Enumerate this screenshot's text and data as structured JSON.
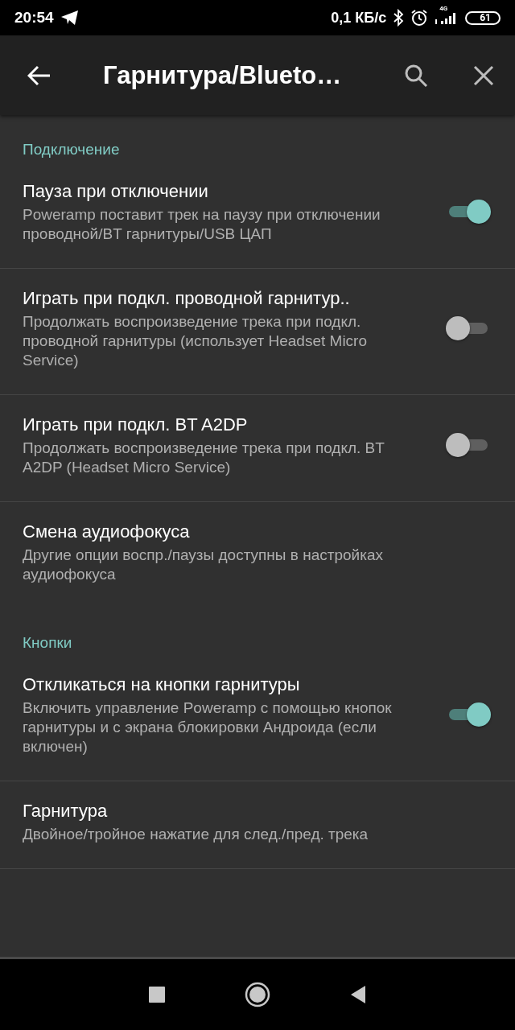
{
  "status_bar": {
    "time": "20:54",
    "speed": "0,1 КБ/с",
    "network": "4G",
    "battery": "61"
  },
  "toolbar": {
    "title": "Гарнитура/Blueto…"
  },
  "sections": [
    {
      "header": "Подключение",
      "items": [
        {
          "kind": "switch",
          "title": "Пауза при отключении",
          "subtitle": "Poweramp поставит трек на паузу при отключении проводной/BT гарнитуры/USB ЦАП",
          "on": true,
          "divider": true
        },
        {
          "kind": "switch",
          "title": "Играть при подкл. проводной гарнитур..",
          "subtitle": "Продолжать воспроизведение трека при подкл. проводной гарнитуры (использует Headset Micro Service)",
          "on": false,
          "divider": true
        },
        {
          "kind": "switch",
          "title": "Играть при подкл. BT A2DP",
          "subtitle": "Продолжать воспроизведение трека при подкл. BT A2DP (Headset Micro Service)",
          "on": false,
          "divider": true
        },
        {
          "kind": "plain",
          "title": "Смена аудиофокуса",
          "subtitle": "Другие опции воспр./паузы доступны в настройках аудиофокуса",
          "divider": false
        }
      ]
    },
    {
      "header": "Кнопки",
      "items": [
        {
          "kind": "switch",
          "title": "Откликаться на кнопки гарнитуры",
          "subtitle": "Включить управление Poweramp с помощью кнопок гарнитуры и с экрана блокировки Андроида (если включен)",
          "on": true,
          "divider": true
        },
        {
          "kind": "plain",
          "title": "Гарнитура",
          "subtitle": "Двойное/тройное нажатие для след./пред. трека",
          "divider": true
        }
      ]
    }
  ]
}
